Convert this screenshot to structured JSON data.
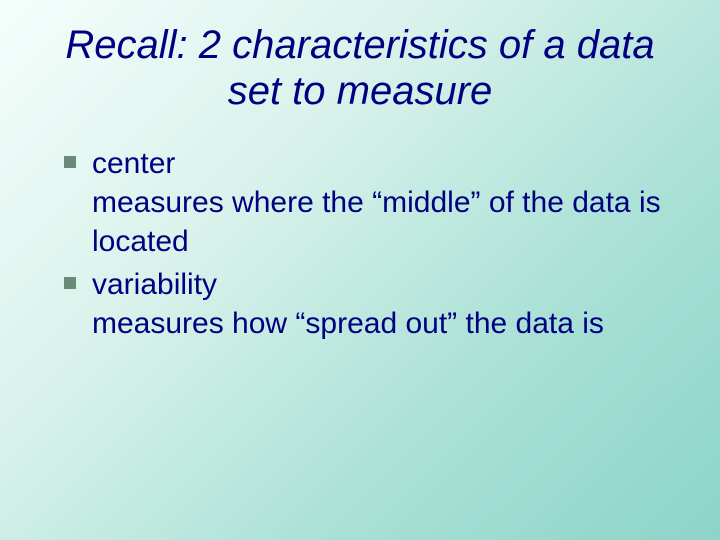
{
  "title": "Recall: 2 characteristics of a data set to measure",
  "items": [
    {
      "heading": "center",
      "desc": "measures where the “middle” of the data is located"
    },
    {
      "heading": "variability",
      "desc": "measures how “spread out” the data is"
    }
  ]
}
